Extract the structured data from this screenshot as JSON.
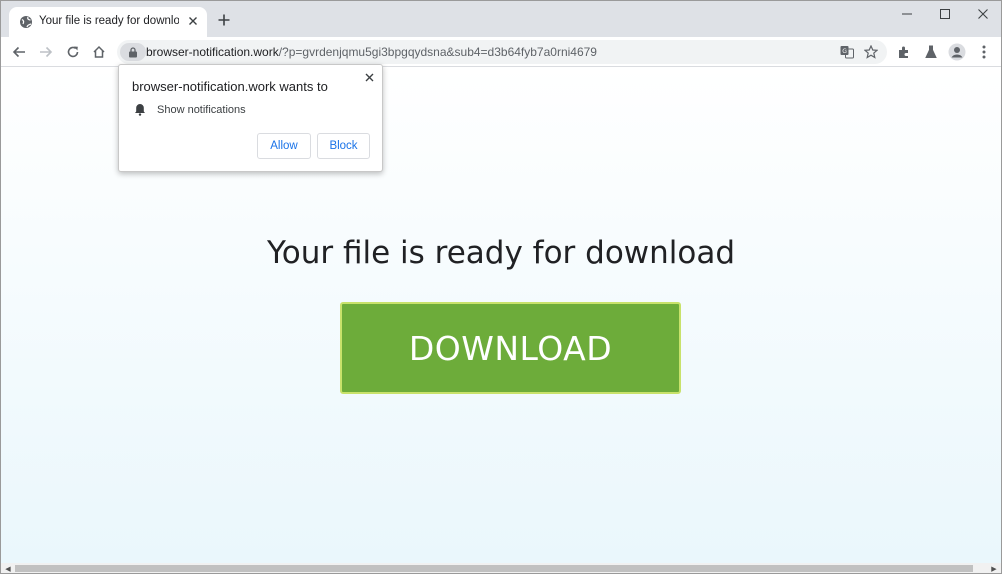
{
  "tab": {
    "title": "Your file is ready for download",
    "favicon": "globe-icon"
  },
  "window_controls": [
    "minimize-icon",
    "maximize-icon",
    "close-icon"
  ],
  "toolbar": {
    "url_host": "browser-notification.work",
    "url_path": "/?p=gvrdenjqmu5gi3bpgqydsna&sub4=d3b64fyb7a0rni4679"
  },
  "permission_prompt": {
    "title": "browser-notification.work wants to",
    "permission": "Show notifications",
    "allow_label": "Allow",
    "block_label": "Block"
  },
  "page": {
    "headline": "Your file is ready for download",
    "download_label": "DOWNLOAD"
  },
  "colors": {
    "download_button": "#6dac3a",
    "download_border": "#c8e26b",
    "prompt_button_text": "#1a73e8",
    "page_gradient_bottom": "#eaf7fc"
  }
}
